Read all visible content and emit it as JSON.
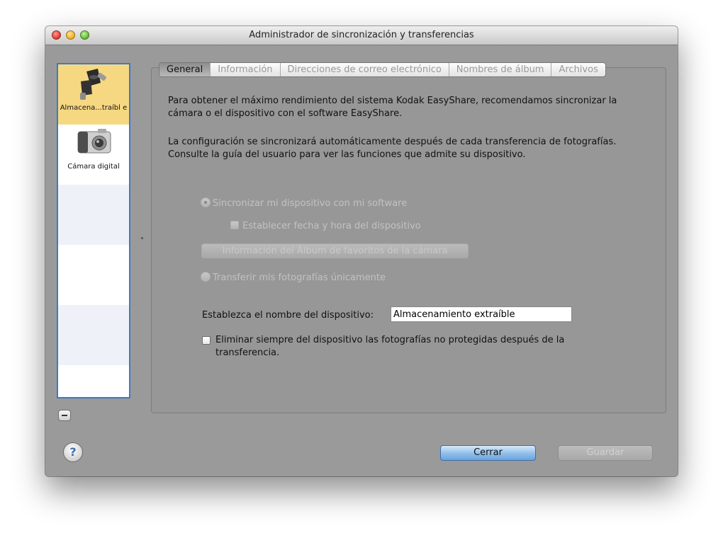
{
  "window": {
    "title": "Administrador de sincronización y transferencias"
  },
  "sidebar": {
    "items": [
      {
        "label": "Almacena...traíbl e",
        "icon": "usb-cables-icon",
        "selected": true
      },
      {
        "label": "Cámara digital",
        "icon": "camera-icon",
        "selected": false
      }
    ]
  },
  "tabs": [
    {
      "label": "General",
      "active": true
    },
    {
      "label": "Información",
      "active": false
    },
    {
      "label": "Direcciones de correo electrónico",
      "active": false
    },
    {
      "label": "Nombres de álbum",
      "active": false
    },
    {
      "label": "Archivos",
      "active": false
    }
  ],
  "general": {
    "intro1": "Para obtener el máximo rendimiento del sistema Kodak EasyShare, recomendamos sincronizar la cámara o el dispositivo con el software EasyShare.",
    "intro2": "La configuración se sincronizará automáticamente después de cada transferencia de fotografías. Consulte la guía del usuario para ver las funciones que admite su dispositivo.",
    "sync_option": "Sincronizar mi dispositivo con mi software",
    "set_datetime": "Establecer fecha y hora del dispositivo",
    "favorites_button": "Información del Álbum de favoritos de la cámara",
    "transfer_only": "Transferir mis fotografías únicamente",
    "device_name_label": "Establezca el nombre del dispositivo:",
    "device_name_value": "Almacenamiento extraíble",
    "delete_always": "Eliminar siempre del dispositivo las fotografías no protegidas después de la transferencia."
  },
  "footer": {
    "help": "?",
    "close": "Cerrar",
    "save": "Guardar"
  }
}
